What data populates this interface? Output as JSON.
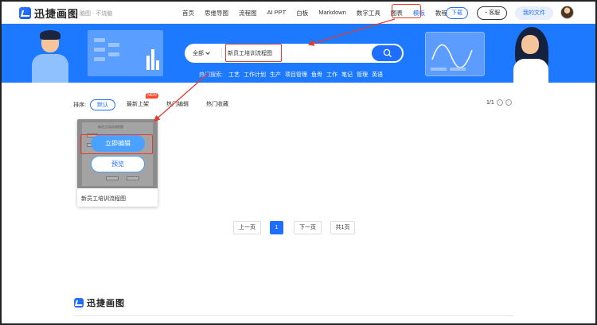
{
  "header": {
    "logo_text": "迅捷画图",
    "slogan": "脑图 · 不烧脑",
    "nav": [
      "首页",
      "思维导图",
      "流程图",
      "AI PPT",
      "白板",
      "Markdown",
      "数字工具",
      "图表",
      "模板",
      "教程"
    ],
    "active_nav": "模板",
    "download_label": "下载",
    "service_label": "客服",
    "my_files_label": "我的文件"
  },
  "search": {
    "scope": "全部",
    "query": "新员工培训流程图",
    "hot_label": "热门搜索:",
    "hot_terms": [
      "工艺",
      "工作计划",
      "生产",
      "项目管理",
      "鱼骨",
      "工作",
      "笔记",
      "管理",
      "英语"
    ]
  },
  "sort": {
    "label": "排序:",
    "options": [
      "默认",
      "最新上架",
      "热门编辑",
      "热门收藏"
    ],
    "new_badge": "NEW",
    "page_indicator": "1/1"
  },
  "results": [
    {
      "title": "新员工培训流程图",
      "thumb_title": "新员工培训流程图",
      "edit_label": "立即编辑",
      "preview_label": "预览"
    }
  ],
  "pagination": {
    "prev": "上一页",
    "current": "1",
    "next": "下一页",
    "total": "共1页"
  },
  "footer": {
    "logo_text": "迅捷画图"
  },
  "colors": {
    "brand": "#1e6fff",
    "banner": "#1d79ff",
    "annotation": "#e53a2c"
  }
}
